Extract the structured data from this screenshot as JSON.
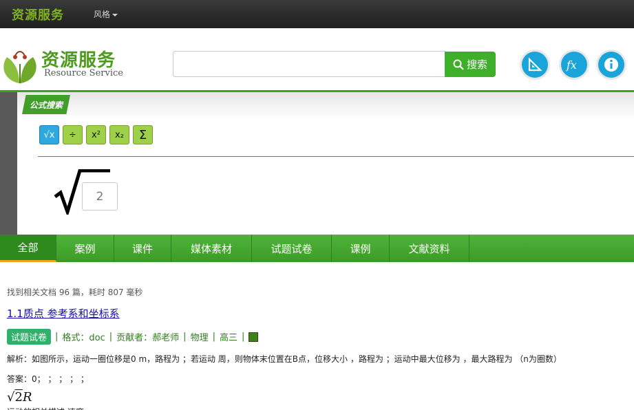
{
  "topbar": {
    "brand": "资源服务",
    "style_menu": "风格"
  },
  "header": {
    "logo_title": "资源服务",
    "logo_subtitle": "Resource Service",
    "search_placeholder": "",
    "search_button": "搜索",
    "tools": [
      "ruler-icon",
      "fx-icon",
      "info-icon"
    ]
  },
  "formula_panel": {
    "tag": "公式搜索",
    "buttons": [
      "√x",
      "÷",
      "x²",
      "x₂",
      "Σ"
    ],
    "input_value": "2"
  },
  "tabs": [
    "全部",
    "案例",
    "课件",
    "媒体素材",
    "试题试卷",
    "课例",
    "文献资料"
  ],
  "results": {
    "summary": "找到相关文档 96 篇，耗时 807 毫秒",
    "title": "1.1质点 参考系和坐标系",
    "type_badge": "试题试卷",
    "format": "格式：doc",
    "contributor": "贡献者：郝老师",
    "subject": "物理",
    "grade": "高三",
    "analysis": "解析：如图所示，运动一圈位移是0 m，路程为 ；若运动 周，则物体末位置在B点，位移大小 ，路程为 ；运动中最大位移为 ，最大路程为 （n为圈数）",
    "answer": "答案：0；  ；  ；  ；  ；",
    "math_radicand": "2",
    "math_var": "R",
    "cut_text": "运动的相关描述  速度"
  },
  "colors": {
    "accent_green": "#3f9f29",
    "tool_blue": "#1aa4d9",
    "tab_underline": "#f2a21c"
  }
}
